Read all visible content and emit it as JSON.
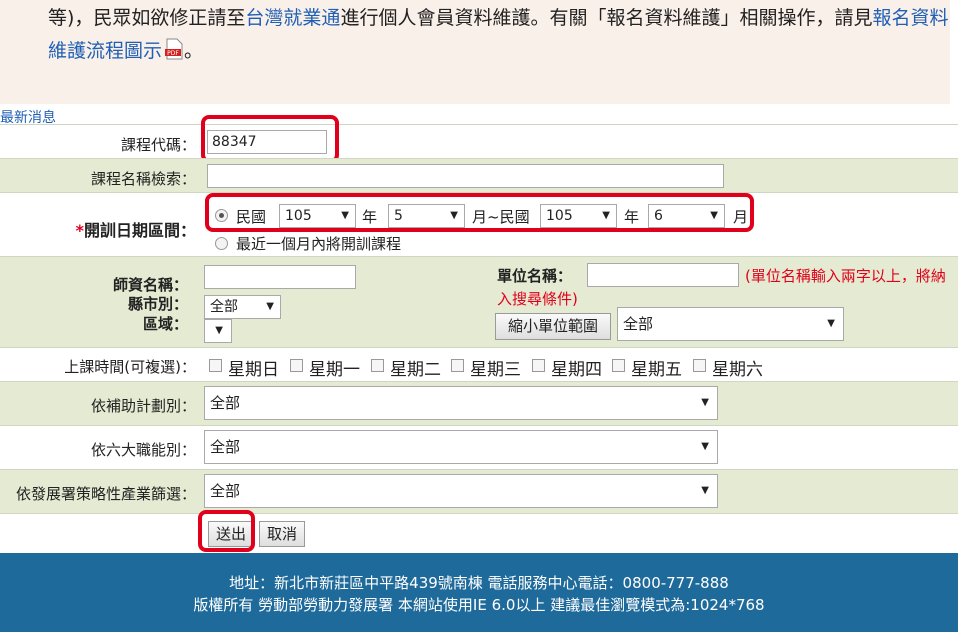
{
  "notice": {
    "text_1": "等)，民眾如欲修正請至",
    "link_1": "台灣就業通",
    "text_2": "進行個人會員資料維護。有關「報名資料維護」相關操作，請見",
    "link_2a": "報名資料",
    "link_2b": "維護流程圖示",
    "text_3": "。"
  },
  "news_link": "最新消息",
  "form": {
    "course_code": {
      "label": "課程代碼：",
      "value": "88347"
    },
    "course_name": {
      "label": "課程名稱檢索：",
      "value": ""
    },
    "date_range": {
      "required_mark": "*",
      "label": "開訓日期區間：",
      "era_1": "民國",
      "from_year": "105",
      "year_unit": "年",
      "from_month": "5",
      "to_text": "月~民國",
      "to_year": "105",
      "to_year_unit": "年",
      "to_month": "6",
      "month_unit": "月",
      "option_recent": "最近一個月內將開訓課程"
    },
    "teacher": {
      "label": "師資名稱：",
      "value": ""
    },
    "city": {
      "label": "縣市別：",
      "value": "全部"
    },
    "area": {
      "label": "區域：",
      "value": ""
    },
    "unit": {
      "label": "單位名稱：",
      "value": "",
      "hint_1": "(單位名稱輸入兩字以上，將納",
      "hint_2": "入搜尋條件)",
      "narrow_button": "縮小單位範圍",
      "select_value": "全部"
    },
    "class_time": {
      "label": "上課時間(可複選)：",
      "days": [
        "星期日",
        "星期一",
        "星期二",
        "星期三",
        "星期四",
        "星期五",
        "星期六"
      ]
    },
    "subsidy": {
      "label": "依補助計劃別：",
      "value": "全部"
    },
    "function": {
      "label": "依六大職能別：",
      "value": "全部"
    },
    "industry": {
      "label": "依發展署策略性產業篩選：",
      "value": "全部"
    },
    "submit": "送出",
    "cancel": "取消"
  },
  "footer": {
    "line_1": "地址：新北市新莊區中平路439號南棟 電話服務中心電話：0800-777-888",
    "line_2": "版權所有 勞動部勞動力發展署 本網站使用IE 6.0以上 建議最佳瀏覽模式為:1024*768"
  },
  "colors": {
    "highlight": "#e0001b",
    "link": "#1f5fb4",
    "row_alt": "#e5ebd2",
    "footer": "#1e6a9b",
    "hint": "#e0001b"
  }
}
